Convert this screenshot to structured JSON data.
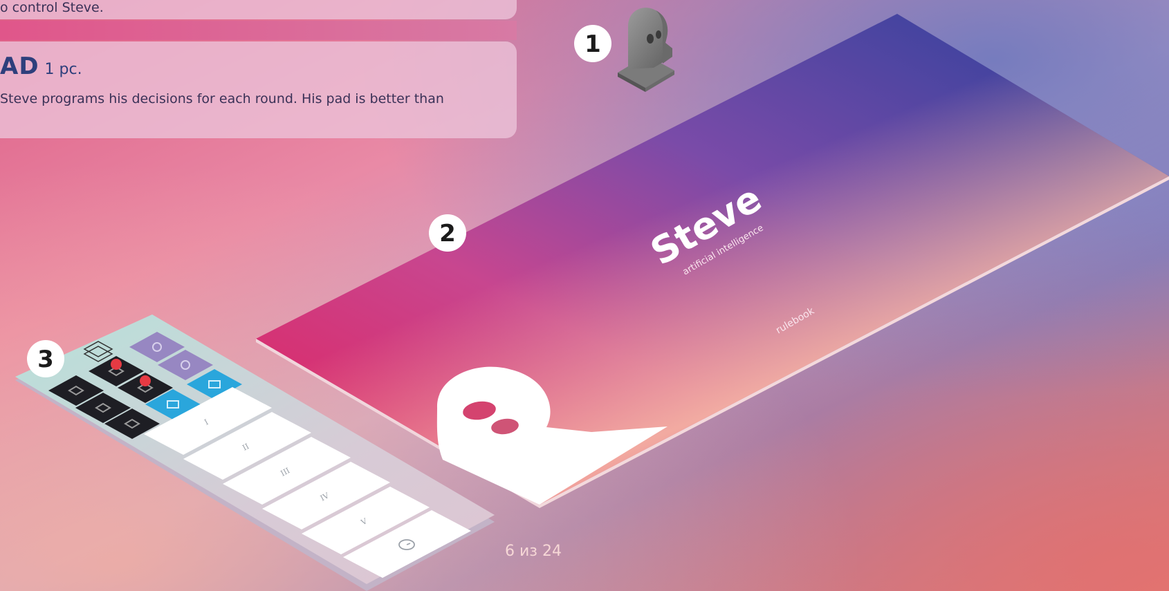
{
  "top_box": {
    "text": "o control Steve."
  },
  "pad_section": {
    "title": "AD",
    "count": "1 pc.",
    "description": "Steve programs his decisions for each round. His pad is better than"
  },
  "badges": [
    "1",
    "2",
    "3"
  ],
  "rulebook": {
    "title": "Steve",
    "subtitle": "artificial intelligence",
    "label": "rulebook"
  },
  "pad_rows": [
    "I",
    "II",
    "III",
    "IV",
    "V"
  ],
  "footer": {
    "page_number": "6 из 24"
  },
  "colors": {
    "heading": "#2e3f7c",
    "badge_bg": "#ffffff",
    "pad_black": "#1e1e24",
    "pad_purple": "#9787c2",
    "pad_blue": "#2aa6dc",
    "pad_base": "#b9dcd8"
  },
  "icons": [
    "head-token-icon",
    "steve-silhouette-icon",
    "tile-icon",
    "monster-icon",
    "gear-icon",
    "truck-icon",
    "clock-icon"
  ]
}
